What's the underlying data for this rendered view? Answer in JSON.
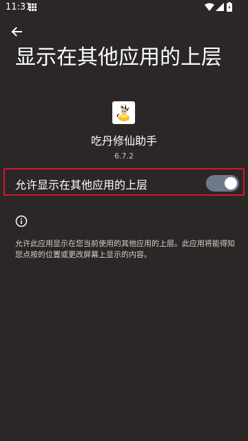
{
  "status_bar": {
    "time": "11:31",
    "icons": [
      "grid-notification-icon",
      "wifi-icon",
      "signal-icon",
      "battery-icon"
    ]
  },
  "header": {
    "back_icon": "back-arrow-icon",
    "title": "显示在其他应用的上层"
  },
  "app": {
    "icon": "app-logo-icon",
    "name": "吃丹修仙助手",
    "version": "6.7.2"
  },
  "setting": {
    "label": "允许显示在其他应用的上层",
    "enabled": true,
    "highlight_color": "#d0192d",
    "switch_track_color": "#6d7a8c"
  },
  "info": {
    "icon": "info-icon",
    "description": "允许此应用显示在您当前使用的其他应用的上层。此应用将能得知您点按的位置或更改屏幕上显示的内容。"
  },
  "colors": {
    "background": "#2a2726",
    "text": "#ffffff"
  }
}
